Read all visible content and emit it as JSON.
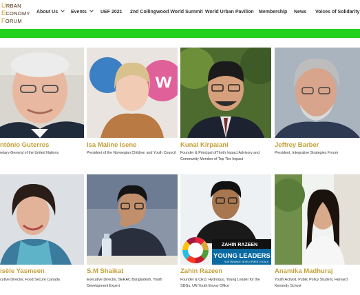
{
  "logo": {
    "line1_cap": "U",
    "line1_rest": "RBAN",
    "line2_cap": "E",
    "line2_rest": "CONOMY",
    "line3_cap": "F",
    "line3_rest": "ORUM"
  },
  "nav": {
    "items": [
      {
        "label": "About Us",
        "dropdown": true
      },
      {
        "label": "Events",
        "dropdown": true
      },
      {
        "label": "UEF 2021",
        "dropdown": false
      },
      {
        "label": "2nd Collingwood World Summit",
        "dropdown": false
      },
      {
        "label": "World Urban Pavilion",
        "dropdown": false
      },
      {
        "label": "Membership",
        "dropdown": false
      },
      {
        "label": "News",
        "dropdown": false
      },
      {
        "label": "Voices of Solidarity",
        "dropdown": false
      }
    ]
  },
  "colors": {
    "accent_green": "#22d21f",
    "name_gold": "#c4a03a",
    "logo_gold": "#c9a227",
    "logo_brown": "#4a2a14"
  },
  "speakers": [
    {
      "name": "ntónio Guterres",
      "role": "retary-General of the United Nations"
    },
    {
      "name": "Isa Maline Isene",
      "role": "President of the Norwegian Children and Youth Council"
    },
    {
      "name": "Kunal Kirpalani",
      "role": "Founder & Principal ofThoth Impact Advisory and Community Member of Top Tier Impact"
    },
    {
      "name": "Jeffrey Barber",
      "role": "President, Integrative Strategies Forum"
    },
    {
      "name": "isèle Yasmeen",
      "role": "cutive Director, Food Secure Canada"
    },
    {
      "name": "S.M Shaikat",
      "role": "Executive Director, SERAC Bangladesh, Youth Development Expert"
    },
    {
      "name": "Zahin Razeen",
      "role": "Founder & CEO, Hydroquo, Young Leader for the SDGs, UN Youth Envoy Office"
    },
    {
      "name": "Anamika Madhuraj",
      "role": "Youth Activist, Public Policy Student, Harvard Kennedy School"
    }
  ],
  "photo_text": {
    "zahin_name": "ZAHIN RAZEEN",
    "zahin_banner": "YOUNG LEADERS",
    "zahin_sub": "SUSTAINABLE DEVELOPMENT GOALS"
  }
}
